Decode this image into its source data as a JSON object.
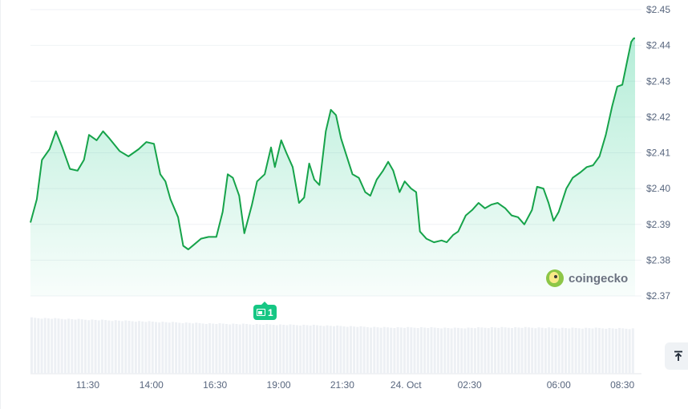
{
  "chart_data": {
    "type": "area",
    "y_ticks": [
      "$2.45",
      "$2.44",
      "$2.43",
      "$2.42",
      "$2.41",
      "$2.40",
      "$2.39",
      "$2.38",
      "$2.37"
    ],
    "y_tick_values": [
      2.45,
      2.44,
      2.43,
      2.42,
      2.41,
      2.4,
      2.39,
      2.38,
      2.37
    ],
    "ylim": [
      2.37,
      2.45
    ],
    "x_ticks": [
      "11:30",
      "14:00",
      "16:30",
      "19:00",
      "21:30",
      "24. Oct",
      "02:30",
      "06:00",
      "08:30"
    ],
    "x_tick_hours": [
      11.5,
      14.0,
      16.5,
      19.0,
      21.5,
      24.0,
      26.5,
      30.0,
      32.5
    ],
    "xlim_hours": [
      9.25,
      33.0
    ],
    "line_color": "#16a34a",
    "fill_color": "#16c784",
    "grid": true,
    "series": [
      {
        "points": [
          [
            9.25,
            2.3905
          ],
          [
            9.5,
            2.397
          ],
          [
            9.7,
            2.408
          ],
          [
            10.0,
            2.411
          ],
          [
            10.25,
            2.416
          ],
          [
            10.5,
            2.4115
          ],
          [
            10.8,
            2.4055
          ],
          [
            11.1,
            2.405
          ],
          [
            11.35,
            2.408
          ],
          [
            11.55,
            2.415
          ],
          [
            11.85,
            2.4135
          ],
          [
            12.1,
            2.416
          ],
          [
            12.35,
            2.414
          ],
          [
            12.75,
            2.4105
          ],
          [
            13.1,
            2.409
          ],
          [
            13.5,
            2.411
          ],
          [
            13.8,
            2.413
          ],
          [
            14.1,
            2.4125
          ],
          [
            14.35,
            2.404
          ],
          [
            14.55,
            2.402
          ],
          [
            14.75,
            2.397
          ],
          [
            15.05,
            2.392
          ],
          [
            15.25,
            2.384
          ],
          [
            15.45,
            2.383
          ],
          [
            15.7,
            2.3845
          ],
          [
            15.95,
            2.386
          ],
          [
            16.25,
            2.3865
          ],
          [
            16.55,
            2.3865
          ],
          [
            16.8,
            2.3935
          ],
          [
            17.0,
            2.404
          ],
          [
            17.2,
            2.403
          ],
          [
            17.45,
            2.398
          ],
          [
            17.65,
            2.3875
          ],
          [
            17.95,
            2.3955
          ],
          [
            18.15,
            2.402
          ],
          [
            18.45,
            2.404
          ],
          [
            18.7,
            2.4115
          ],
          [
            18.85,
            2.406
          ],
          [
            19.1,
            2.4135
          ],
          [
            19.3,
            2.41
          ],
          [
            19.55,
            2.406
          ],
          [
            19.8,
            2.396
          ],
          [
            20.0,
            2.3975
          ],
          [
            20.2,
            2.407
          ],
          [
            20.4,
            2.4025
          ],
          [
            20.6,
            2.401
          ],
          [
            20.85,
            2.416
          ],
          [
            21.05,
            2.422
          ],
          [
            21.25,
            2.4205
          ],
          [
            21.45,
            2.414
          ],
          [
            21.65,
            2.4095
          ],
          [
            21.9,
            2.404
          ],
          [
            22.15,
            2.403
          ],
          [
            22.4,
            2.399
          ],
          [
            22.6,
            2.398
          ],
          [
            22.85,
            2.4025
          ],
          [
            23.1,
            2.405
          ],
          [
            23.3,
            2.4075
          ],
          [
            23.5,
            2.405
          ],
          [
            23.75,
            2.399
          ],
          [
            23.95,
            2.402
          ],
          [
            24.2,
            2.4
          ],
          [
            24.4,
            2.399
          ],
          [
            24.55,
            2.388
          ],
          [
            24.8,
            2.386
          ],
          [
            25.1,
            2.385
          ],
          [
            25.4,
            2.3855
          ],
          [
            25.6,
            2.385
          ],
          [
            25.85,
            2.387
          ],
          [
            26.05,
            2.388
          ],
          [
            26.35,
            2.3925
          ],
          [
            26.6,
            2.394
          ],
          [
            26.85,
            2.396
          ],
          [
            27.1,
            2.3945
          ],
          [
            27.35,
            2.3955
          ],
          [
            27.6,
            2.396
          ],
          [
            27.9,
            2.3945
          ],
          [
            28.15,
            2.3925
          ],
          [
            28.4,
            2.392
          ],
          [
            28.65,
            2.39
          ],
          [
            28.95,
            2.394
          ],
          [
            29.15,
            2.4005
          ],
          [
            29.4,
            2.4
          ],
          [
            29.6,
            2.396
          ],
          [
            29.8,
            2.391
          ],
          [
            30.0,
            2.3935
          ],
          [
            30.3,
            2.4
          ],
          [
            30.55,
            2.403
          ],
          [
            30.85,
            2.4045
          ],
          [
            31.1,
            2.406
          ],
          [
            31.35,
            2.4065
          ],
          [
            31.6,
            2.409
          ],
          [
            31.85,
            2.415
          ],
          [
            32.1,
            2.423
          ],
          [
            32.3,
            2.4285
          ],
          [
            32.5,
            2.429
          ],
          [
            32.7,
            2.436
          ],
          [
            32.85,
            2.441
          ],
          [
            32.95,
            2.442
          ],
          [
            33.0,
            2.442
          ]
        ]
      }
    ],
    "volume_bars": {
      "count": 180,
      "levels": [
        0.99,
        0.97,
        0.95,
        0.93,
        0.91,
        0.89,
        0.88,
        0.87,
        0.86,
        0.84,
        0.82,
        0.82,
        0.81,
        0.82,
        0.82,
        0.81,
        0.81,
        0.8
      ]
    }
  },
  "event_badge": {
    "count": "1",
    "icon": "document-icon"
  },
  "watermark": {
    "text": "coingecko",
    "icon": "coingecko-gecko-icon"
  },
  "scroll_button": {
    "icon": "arrow-up-to-line-icon"
  }
}
